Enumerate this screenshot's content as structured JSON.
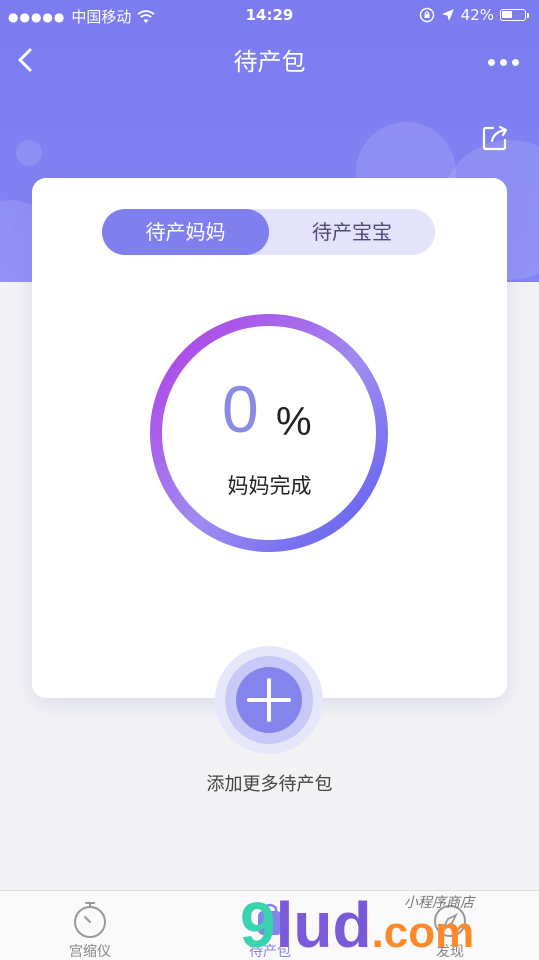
{
  "status_bar": {
    "signal_dots": "●●●●●",
    "carrier": "中国移动",
    "time": "14:29",
    "battery": "42%"
  },
  "nav": {
    "title": "待产包"
  },
  "segment": {
    "active": "待产妈妈",
    "inactive": "待产宝宝"
  },
  "progress": {
    "value": "0",
    "unit": "%",
    "label": "妈妈完成",
    "fraction": 0
  },
  "add": {
    "label": "添加更多待产包"
  },
  "tabbar": {
    "items": [
      {
        "label": "宫缩仪"
      },
      {
        "label": "待产包"
      },
      {
        "label": "发现"
      }
    ]
  },
  "watermark": {
    "main_a": "9",
    "main_b": "lud",
    "main_c": ".com",
    "small": "小程序商店"
  },
  "colors": {
    "header": "#7b7cf0",
    "accent": "#7f80ee",
    "ring_start": "#b13ce6",
    "ring_end": "#5b5cf0"
  }
}
